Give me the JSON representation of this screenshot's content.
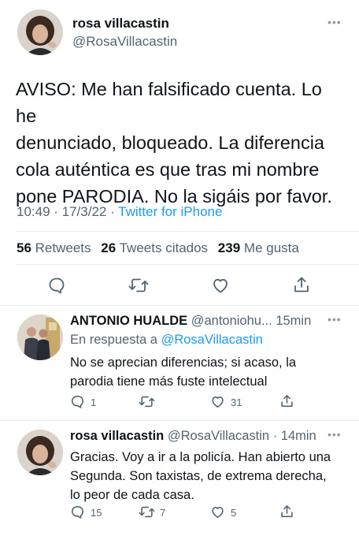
{
  "main_tweet": {
    "author_name": "rosa villacastin",
    "author_handle": "@RosaVillacastin",
    "text_lines": [
      "AVISO: Me han falsificado cuenta. Lo he",
      "denunciado, bloqueado. La diferencia",
      "cola auténtica es que tras mi nombre",
      "pone PARODIA. No la sigáis por favor."
    ],
    "time": "10:49 · 17/3/22 · ",
    "source": "Twitter for iPhone",
    "stats": {
      "retweets_count": "56",
      "retweets_label": "Retweets",
      "quotes_count": "26",
      "quotes_label": "Tweets citados",
      "likes_count": "239",
      "likes_label": "Me gusta"
    }
  },
  "replies": [
    {
      "author_name": "ANTONIO HUALDE",
      "author_handle": "@antoniohu...",
      "time": "15min",
      "reply_to_prefix": "En respuesta a ",
      "reply_to_handle": "@RosaVillacastin",
      "text_lines": [
        "No se aprecian diferencias; si acaso, la",
        "parodia tiene más fuste intelectual"
      ],
      "reply_count": "1",
      "retweet_count": "",
      "like_count": "31"
    },
    {
      "author_name": "rosa villacastin",
      "author_handle": "@RosaVillacastin",
      "time": "· 14min",
      "text_lines": [
        "Gracias. Voy a ir a la policía. Han abierto una",
        "Segunda. Son taxistas, de extrema derecha,",
        "lo peor de cada casa."
      ],
      "reply_count": "15",
      "retweet_count": "7",
      "like_count": "5"
    }
  ],
  "icons": {
    "more": "more-horizontal-icon",
    "reply": "comment-bubble-icon",
    "retweet": "retweet-arrows-icon",
    "like": "heart-icon",
    "share": "share-upload-icon"
  },
  "colors": {
    "link": "#1d9bf0",
    "secondary_text": "#536471",
    "icon": "#536471",
    "divider": "#e6ecf0"
  }
}
